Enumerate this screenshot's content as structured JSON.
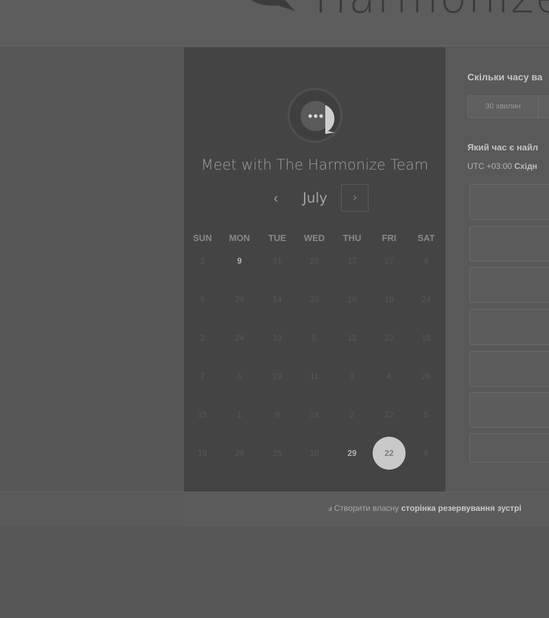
{
  "header": {
    "brand_name": "Harmonize"
  },
  "meeting": {
    "title": "Meet with The Harmonize Team"
  },
  "calendar": {
    "month": "July",
    "prev_symbol": "‹",
    "next_symbol": "›",
    "weekdays": [
      "SUN",
      "MON",
      "TUE",
      "WED",
      "THU",
      "FRI",
      "SAT"
    ],
    "weeks": [
      [
        "3",
        "9",
        "31",
        "20",
        "17",
        "27",
        "9"
      ],
      [
        "9",
        "24",
        "14",
        "30",
        "10",
        "18",
        "24"
      ],
      [
        "2",
        "24",
        "19",
        "5",
        "12",
        "22",
        "18"
      ],
      [
        "7",
        "5",
        "19",
        "11",
        "3",
        "4",
        "26"
      ],
      [
        "15",
        "1",
        "9",
        "18",
        "2",
        "22",
        "5"
      ],
      [
        "19",
        "29",
        "25",
        "10",
        "29",
        "22",
        "6"
      ]
    ],
    "active_days": [
      "0-1",
      "5-4",
      "5-5"
    ],
    "selected_day": "5-5"
  },
  "booking": {
    "duration_question": "Скільки часу ва",
    "duration_options": [
      "30 хвилин"
    ],
    "time_question": "Який час є найл",
    "timezone_offset": "UTC +03:00",
    "timezone_name": "Східн",
    "slots_visible": 7
  },
  "footer": {
    "prefix": "Створити власну",
    "bold": "сторінка резервування зустрі",
    "icon": "sprocket-icon"
  },
  "colors": {
    "panel": "#444444",
    "selected_day": "#c9c9c9",
    "background": "#575757"
  }
}
